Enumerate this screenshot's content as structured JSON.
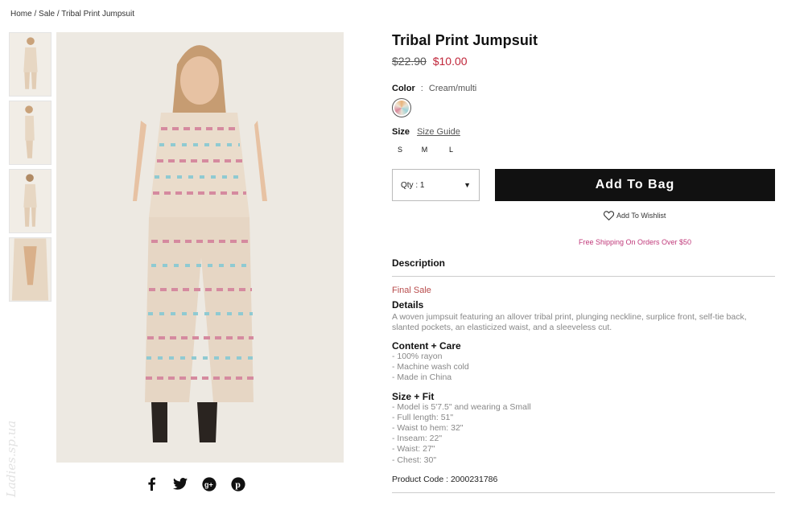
{
  "breadcrumb": {
    "home": "Home",
    "sale": "Sale",
    "current": "Tribal Print Jumpsuit",
    "separator": "/"
  },
  "product": {
    "title": "Tribal Print Jumpsuit",
    "original_price": "$22.90",
    "sale_price": "$10.00",
    "color_label": "Color",
    "color_sep": ":",
    "color_value": "Cream/multi",
    "size_label": "Size",
    "size_guide": "Size Guide",
    "sizes": [
      "S",
      "M",
      "L"
    ],
    "qty_label": "Qty : 1",
    "add_to_bag": "Add To Bag",
    "wishlist": "Add To Wishlist",
    "free_shipping": "Free Shipping On Orders Over $50"
  },
  "description": {
    "heading": "Description",
    "final_sale": "Final Sale",
    "details_title": "Details",
    "details_text": "A woven jumpsuit featuring an allover tribal print, plunging neckline, surplice front, self-tie back, slanted pockets, an elasticized waist, and a sleeveless cut.",
    "content_title": "Content + Care",
    "content_items": [
      "- 100% rayon",
      "- Machine wash cold",
      "- Made in China"
    ],
    "fit_title": "Size + Fit",
    "fit_items": [
      "- Model is 5'7.5\" and wearing a Small",
      "- Full length: 51\"",
      "- Waist to hem: 32\"",
      "- Inseam: 22\"",
      "- Waist: 27\"",
      "- Chest: 30\""
    ],
    "product_code": "Product Code : 2000231786"
  },
  "social": {
    "icons": [
      "facebook-icon",
      "twitter-icon",
      "google-plus-icon",
      "pinterest-icon"
    ]
  },
  "colors": {
    "sale": "#c0263a",
    "button": "#111111",
    "shipping": "#c0397a",
    "final_sale": "#b84c4c"
  }
}
